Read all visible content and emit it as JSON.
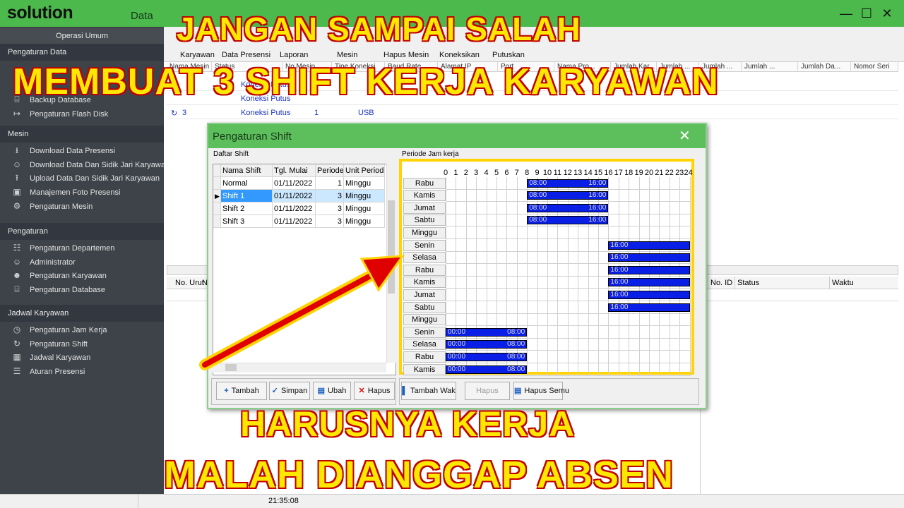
{
  "app": {
    "logo": "solution",
    "menu_first": "Data"
  },
  "sidebar": {
    "top_label": "Operasi Umum",
    "sections": [
      {
        "title": "Pengaturan Data",
        "items": [
          {
            "label": "Backup Database",
            "icon": "database-icon"
          },
          {
            "label": "Pengaturan Flash Disk",
            "icon": "usb-icon"
          }
        ]
      },
      {
        "title": "Mesin",
        "items": [
          {
            "label": "Download Data Presensi",
            "icon": "download-icon"
          },
          {
            "label": "Download Data Dan Sidik Jari Karyawan",
            "icon": "download-user-icon"
          },
          {
            "label": "Upload Data Dan Sidik Jari Karyawan",
            "icon": "upload-icon"
          },
          {
            "label": "Manajemen Foto Presensi",
            "icon": "photo-icon"
          },
          {
            "label": "Pengaturan Mesin",
            "icon": "gear-icon"
          }
        ]
      },
      {
        "title": "Pengaturan",
        "items": [
          {
            "label": "Pengaturan Departemen",
            "icon": "department-icon"
          },
          {
            "label": "Administrator",
            "icon": "user-icon"
          },
          {
            "label": "Pengaturan Karyawan",
            "icon": "users-icon"
          },
          {
            "label": "Pengaturan Database",
            "icon": "database-icon"
          }
        ]
      },
      {
        "title": "Jadwal Karyawan",
        "items": [
          {
            "label": "Pengaturan Jam Kerja",
            "icon": "clock-icon"
          },
          {
            "label": "Pengaturan Shift",
            "icon": "shift-icon"
          },
          {
            "label": "Jadwal Karyawan",
            "icon": "calendar-icon"
          },
          {
            "label": "Aturan Presensi",
            "icon": "rules-icon"
          }
        ]
      }
    ]
  },
  "toolbar": {
    "labels": [
      "Karyawan",
      "Data Presensi",
      "Laporan",
      "Mesin",
      "Hapus Mesin",
      "Koneksikan",
      "Putuskan"
    ]
  },
  "device_table": {
    "headers": [
      "Nama Mesin",
      "Status",
      "No Mesin",
      "Tipe Koneksi",
      "Baud Rate",
      "Alamat IP",
      "Port",
      "Nama Pro...",
      "Jumlah Kar...",
      "Jumlah ...",
      "Jumlah ...",
      "Jumlah ...",
      "Jumlah Da...",
      "Nomor Seri"
    ],
    "rows": [
      {
        "name": "",
        "status": "Koneksi Putus",
        "no": "",
        "type": ""
      },
      {
        "name": "",
        "status": "Koneksi Putus",
        "no": "",
        "type": ""
      },
      {
        "name": "3",
        "status": "Koneksi Putus",
        "no": "1",
        "type": "USB"
      }
    ]
  },
  "lower_table": {
    "left_headers": [
      "No. Urut",
      "N"
    ],
    "right_headers": [
      "No. ID",
      "Status",
      "Waktu"
    ]
  },
  "status_bar": {
    "time": "21:35:08"
  },
  "dialog": {
    "title": "Pengaturan Shift",
    "left_group": "Daftar Shift",
    "right_group": "Periode Jam kerja",
    "shift_headers": [
      "Nama Shift",
      "Tgl. Mulai",
      "Periode",
      "Unit Periode"
    ],
    "shifts": [
      {
        "name": "Normal",
        "start": "01/11/2022",
        "period": "1",
        "unit": "Minggu"
      },
      {
        "name": "Shift 1",
        "start": "01/11/2022",
        "period": "3",
        "unit": "Minggu"
      },
      {
        "name": "Shift 2",
        "start": "01/11/2022",
        "period": "3",
        "unit": "Minggu"
      },
      {
        "name": "Shift 3",
        "start": "01/11/2022",
        "period": "3",
        "unit": "Minggu"
      }
    ],
    "selected_index": 1,
    "buttons_left": [
      "Tambah",
      "Simpan",
      "Ubah",
      "Hapus"
    ],
    "buttons_right": [
      "Tambah Wak",
      "Hapus",
      "Hapus Semu"
    ],
    "hours": [
      "0",
      "1",
      "2",
      "3",
      "4",
      "5",
      "6",
      "7",
      "8",
      "9",
      "10",
      "11",
      "12",
      "13",
      "14",
      "15",
      "16",
      "17",
      "18",
      "19",
      "20",
      "21",
      "22",
      "23",
      "24"
    ],
    "schedule": [
      {
        "day": "Rabu",
        "start": 8,
        "end": 16,
        "label_start": "08:00",
        "label_end": "16:00"
      },
      {
        "day": "Kamis",
        "start": 8,
        "end": 16,
        "label_start": "08:00",
        "label_end": "16:00"
      },
      {
        "day": "Jumat",
        "start": 8,
        "end": 16,
        "label_start": "08:00",
        "label_end": "16:00"
      },
      {
        "day": "Sabtu",
        "start": 8,
        "end": 16,
        "label_start": "08:00",
        "label_end": "16:00"
      },
      {
        "day": "Minggu"
      },
      {
        "day": "Senin",
        "start": 16,
        "end": 24,
        "label_start": "16:00",
        "label_end": ""
      },
      {
        "day": "Selasa",
        "start": 16,
        "end": 24,
        "label_start": "16:00",
        "label_end": ""
      },
      {
        "day": "Rabu",
        "start": 16,
        "end": 24,
        "label_start": "16:00",
        "label_end": ""
      },
      {
        "day": "Kamis",
        "start": 16,
        "end": 24,
        "label_start": "16:00",
        "label_end": ""
      },
      {
        "day": "Jumat",
        "start": 16,
        "end": 24,
        "label_start": "16:00",
        "label_end": ""
      },
      {
        "day": "Sabtu",
        "start": 16,
        "end": 24,
        "label_start": "16:00",
        "label_end": ""
      },
      {
        "day": "Minggu"
      },
      {
        "day": "Senin",
        "start": 0,
        "end": 8,
        "label_start": "00:00",
        "label_end": "08:00"
      },
      {
        "day": "Selasa",
        "start": 0,
        "end": 8,
        "label_start": "00:00",
        "label_end": "08:00"
      },
      {
        "day": "Rabu",
        "start": 0,
        "end": 8,
        "label_start": "00:00",
        "label_end": "08:00"
      },
      {
        "day": "Kamis",
        "start": 0,
        "end": 8,
        "label_start": "00:00",
        "label_end": "08:00"
      }
    ]
  },
  "overlay": {
    "line1": "JANGAN SAMPAI SALAH",
    "line2": "MEMBUAT 3 SHIFT KERJA KARYAWAN",
    "line3": "HARUSNYA KERJA",
    "line4": "MALAH DIANGGAP ABSEN",
    "text_color": "#ffe800",
    "stroke_color": "#c00000",
    "arrow_color": "#e00000"
  }
}
